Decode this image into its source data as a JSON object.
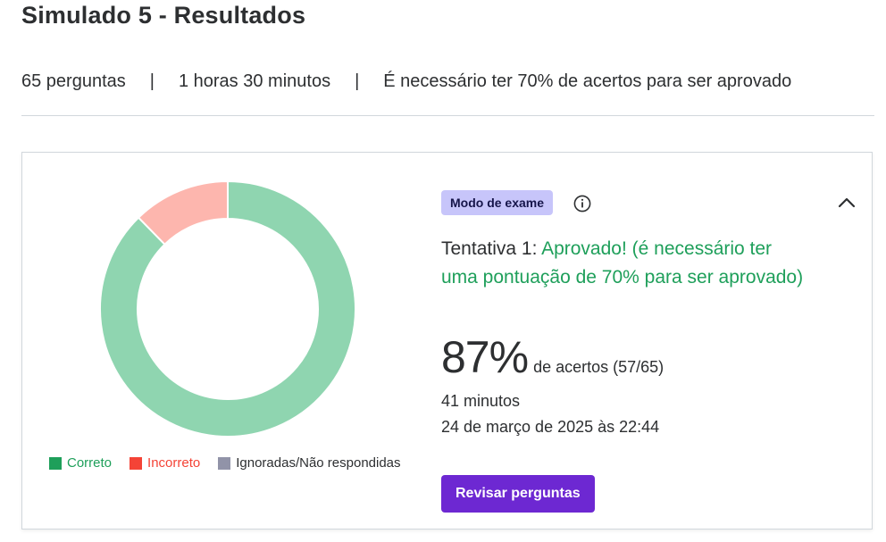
{
  "header": {
    "title": "Simulado 5 - Resultados",
    "questions": "65 perguntas",
    "separator": "|",
    "duration": "1 horas 30 minutos",
    "requirement": "É necessário ter 70% de acertos para ser aprovado"
  },
  "result": {
    "mode_badge": "Modo de exame",
    "attempt_prefix": "Tentativa 1: ",
    "attempt_status": "Aprovado! (é necessário ter uma pontuação de 70% para ser aprovado)",
    "score_percent": "87%",
    "score_label": "de acertos (57/65)",
    "time_spent": "41 minutos",
    "date": "24 de março de 2025 às 22:44",
    "review_button": "Revisar perguntas",
    "icons": {
      "info": "info-icon",
      "collapse": "chevron-up-icon"
    }
  },
  "chart_data": {
    "type": "pie",
    "categories": [
      "Correto",
      "Incorreto",
      "Ignoradas/Não respondidas"
    ],
    "values": [
      57,
      8,
      0
    ],
    "colors": [
      "#8fd5b0",
      "#fdb6ae",
      "#9193a8"
    ],
    "legend_colors": [
      "#1e9f5a",
      "#f44336",
      "#9193a8"
    ],
    "legend_text_colors": [
      "#1e9f5a",
      "#f44336",
      "#2d2f31"
    ],
    "legend_position": "bottom"
  }
}
